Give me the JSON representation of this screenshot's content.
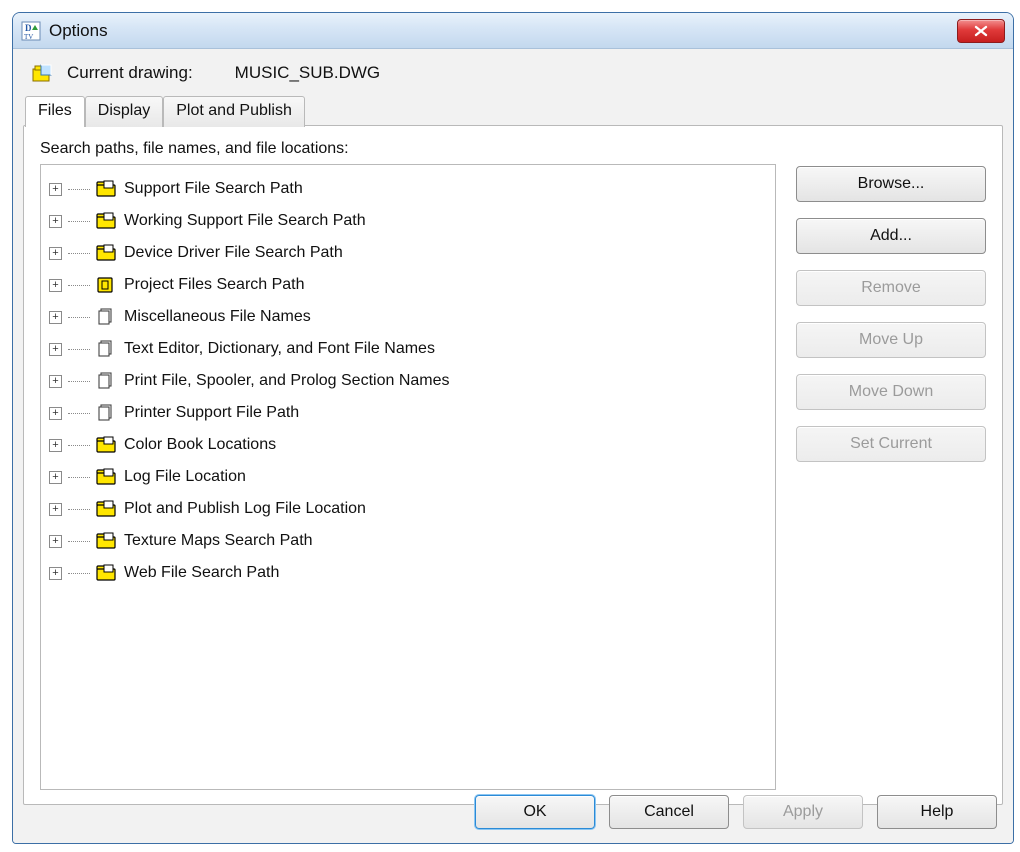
{
  "window": {
    "title": "Options"
  },
  "drawing": {
    "label": "Current drawing:",
    "value": "MUSIC_SUB.DWG"
  },
  "tabs": [
    {
      "label": "Files",
      "active": true
    },
    {
      "label": "Display",
      "active": false
    },
    {
      "label": "Plot and Publish",
      "active": false
    }
  ],
  "section_label": "Search paths, file names, and file locations:",
  "tree": [
    {
      "icon": "folder",
      "label": "Support File Search Path"
    },
    {
      "icon": "folder",
      "label": "Working Support File Search Path"
    },
    {
      "icon": "folder",
      "label": "Device Driver File Search Path"
    },
    {
      "icon": "box",
      "label": "Project Files Search Path"
    },
    {
      "icon": "stack",
      "label": "Miscellaneous File Names"
    },
    {
      "icon": "stack",
      "label": "Text Editor, Dictionary, and Font File Names"
    },
    {
      "icon": "stack",
      "label": "Print File, Spooler, and Prolog Section Names"
    },
    {
      "icon": "stack",
      "label": "Printer Support File Path"
    },
    {
      "icon": "folder",
      "label": "Color Book Locations"
    },
    {
      "icon": "folder",
      "label": "Log File Location"
    },
    {
      "icon": "folder",
      "label": "Plot and Publish Log File Location"
    },
    {
      "icon": "folder",
      "label": "Texture Maps Search Path"
    },
    {
      "icon": "folder",
      "label": "Web File Search Path"
    }
  ],
  "side_buttons": [
    {
      "label": "Browse...",
      "enabled": true
    },
    {
      "label": "Add...",
      "enabled": true
    },
    {
      "label": "Remove",
      "enabled": false
    },
    {
      "label": "Move Up",
      "enabled": false
    },
    {
      "label": "Move Down",
      "enabled": false
    },
    {
      "label": "Set Current",
      "enabled": false
    }
  ],
  "dialog_buttons": [
    {
      "label": "OK",
      "role": "ok",
      "primary": true,
      "enabled": true
    },
    {
      "label": "Cancel",
      "role": "cancel",
      "primary": false,
      "enabled": true
    },
    {
      "label": "Apply",
      "role": "apply",
      "primary": false,
      "enabled": false
    },
    {
      "label": "Help",
      "role": "help",
      "primary": false,
      "enabled": true
    }
  ]
}
